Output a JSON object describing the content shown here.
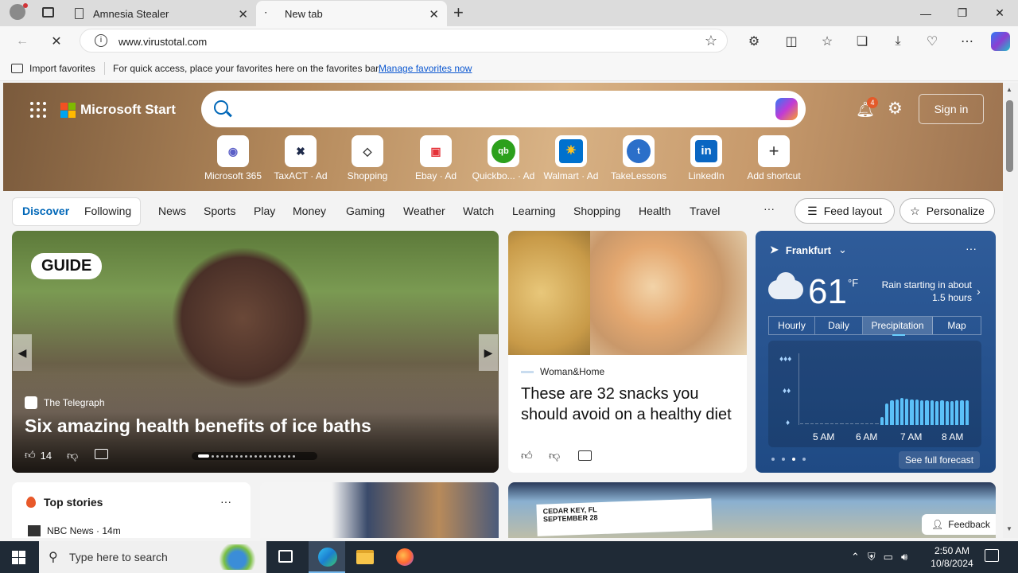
{
  "browser": {
    "tabs": [
      {
        "title": "Amnesia Stealer"
      },
      {
        "title": "New tab"
      }
    ],
    "url": "www.virustotal.com"
  },
  "favorites_bar": {
    "import_label": "Import favorites",
    "hint": "For quick access, place your favorites here on the favorites bar.",
    "manage_link": "Manage favorites now"
  },
  "msn": {
    "brand": "Microsoft Start",
    "notification_count": "4",
    "sign_in": "Sign in",
    "shortcuts": [
      {
        "label": "Microsoft 365",
        "icon": "microsoft-365-icon"
      },
      {
        "label": "TaxACT · Ad",
        "icon": "taxact-icon"
      },
      {
        "label": "Shopping",
        "icon": "shopping-tag-icon"
      },
      {
        "label": "Ebay · Ad",
        "icon": "ebay-bag-icon"
      },
      {
        "label": "Quickbo... · Ad",
        "icon": "quickbooks-icon"
      },
      {
        "label": "Walmart · Ad",
        "icon": "walmart-icon"
      },
      {
        "label": "TakeLessons",
        "icon": "takelessons-icon"
      },
      {
        "label": "LinkedIn",
        "icon": "linkedin-icon"
      },
      {
        "label": "Add shortcut",
        "icon": "plus-icon"
      }
    ],
    "nav": {
      "discover": "Discover",
      "following": "Following",
      "items": [
        "News",
        "Sports",
        "Play",
        "Money",
        "Gaming",
        "Weather",
        "Watch",
        "Learning",
        "Shopping",
        "Health",
        "Travel"
      ],
      "more": "···",
      "feed_layout": "Feed layout",
      "personalize": "Personalize"
    },
    "hero_card": {
      "badge": "GUIDE",
      "source": "The Telegraph",
      "headline": "Six amazing health benefits of ice baths",
      "likes": "14"
    },
    "food_card": {
      "source": "Woman&Home",
      "headline": "These are 32 snacks you should avoid on a healthy diet"
    },
    "weather": {
      "location": "Frankfurt",
      "temp": "61",
      "unit": "°F",
      "condition": "Rain starting in about 1.5 hours",
      "tabs": [
        "Hourly",
        "Daily",
        "Precipitation",
        "Map"
      ],
      "active_tab": "Precipitation",
      "times": [
        "5 AM",
        "6 AM",
        "7 AM",
        "8 AM"
      ],
      "see_full": "See full forecast",
      "precip_bars": [
        0,
        0,
        0,
        0,
        0,
        0,
        0,
        0,
        0,
        0,
        0,
        0,
        0,
        0,
        0,
        0,
        0.3,
        0.8,
        0.9,
        0.95,
        1.0,
        0.97,
        0.95,
        0.93,
        0.92,
        0.9,
        0.9,
        0.88,
        0.9,
        0.88,
        0.88,
        0.9,
        0.92,
        0.92
      ]
    },
    "top_stories": {
      "title": "Top stories",
      "first_source": "NBC News · 14m"
    },
    "feedback": "Feedback"
  },
  "taskbar": {
    "search_placeholder": "Type here to search",
    "time": "2:50 AM",
    "date": "10/8/2024"
  }
}
